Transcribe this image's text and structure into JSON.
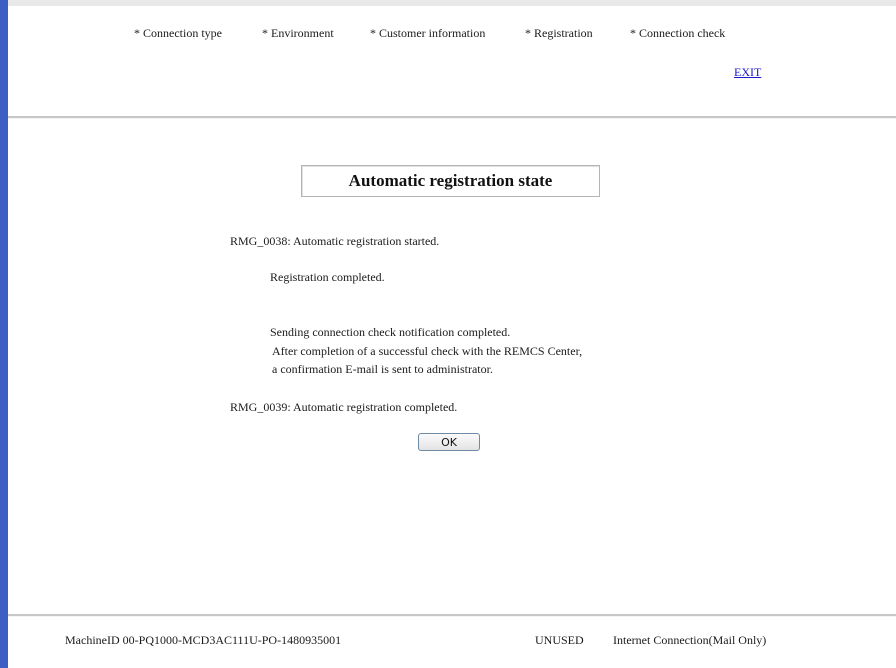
{
  "steps": [
    "* Connection type",
    "* Environment",
    "* Customer information",
    "* Registration",
    "* Connection check"
  ],
  "exit_label": "EXIT",
  "title": "Automatic registration state",
  "messages": {
    "started": "RMG_0038: Automatic registration started.",
    "registration_completed": "Registration completed.",
    "sending_completed": "Sending connection check notification completed.",
    "note_line1": "After completion of a successful check with the REMCS Center,",
    "note_line2": "a confirmation E-mail is sent to administrator.",
    "completed": "RMG_0039: Automatic registration completed."
  },
  "ok_label": "OK",
  "footer": {
    "machine_id": "MachineID  00-PQ1000-MCD3AC111U-PO-1480935001",
    "status": "UNUSED",
    "connection": "Internet Connection(Mail Only)"
  },
  "colors": {
    "left_border": "#3c5fc4",
    "link": "#1a1acc"
  }
}
